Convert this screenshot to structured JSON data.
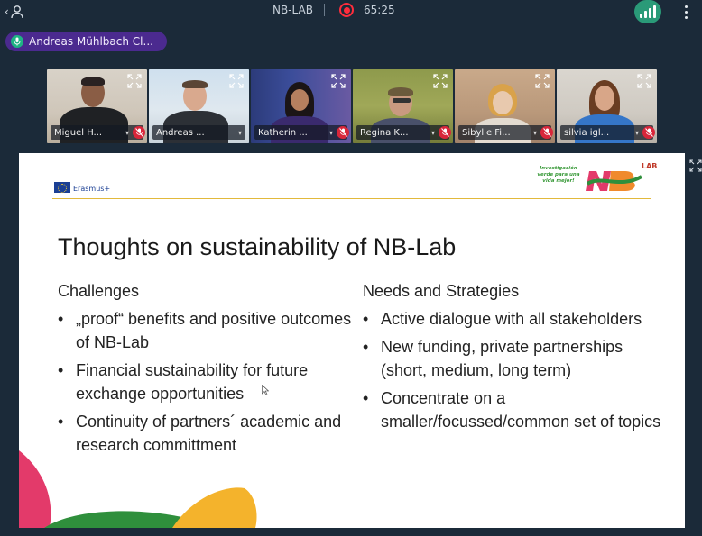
{
  "topbar": {
    "meeting_title": "NB-LAB",
    "recording_time": "65:25"
  },
  "speaker": {
    "name": "Andreas Mühlbach Cl..."
  },
  "participants": [
    {
      "name": "Miguel H...",
      "active": false
    },
    {
      "name": "Andreas ...",
      "active": true
    },
    {
      "name": "Katherin ...",
      "active": false
    },
    {
      "name": "Regina K...",
      "active": false
    },
    {
      "name": "Sibylle Fi...",
      "active": false
    },
    {
      "name": "silvia igl...",
      "active": false
    }
  ],
  "slide": {
    "program_label": "Erasmus+",
    "logo_slogan": "Investigación verde para una vida mejor!",
    "logo_lab": "LAB",
    "title": "Thoughts on sustainability of NB-Lab",
    "left_column": {
      "heading": "Challenges",
      "bullets": [
        "„proof“ benefits and positive outcomes of NB-Lab",
        "Financial sustainability for future exchange opportunities",
        "Continuity of partners´ academic and research committment"
      ]
    },
    "right_column": {
      "heading": "Needs and Strategies",
      "bullets": [
        "Active dialogue with all stakeholders",
        "New funding, private partnerships (short, medium, long term)",
        "Concentrate on a smaller/focussed/common set of topics"
      ]
    }
  },
  "colors": {
    "background": "#1b2a39",
    "speaker_chip": "#4b2a8f",
    "recording": "#ff2d3c",
    "signal": "#2a9a78",
    "muted": "#d9263a",
    "active_tile": "#6aa7ff"
  },
  "icons": [
    "back-icon",
    "person-icon",
    "record-icon",
    "signal-icon",
    "more-icon",
    "mic-icon",
    "expand-icon",
    "mic-muted-icon",
    "chevron-down-icon"
  ]
}
